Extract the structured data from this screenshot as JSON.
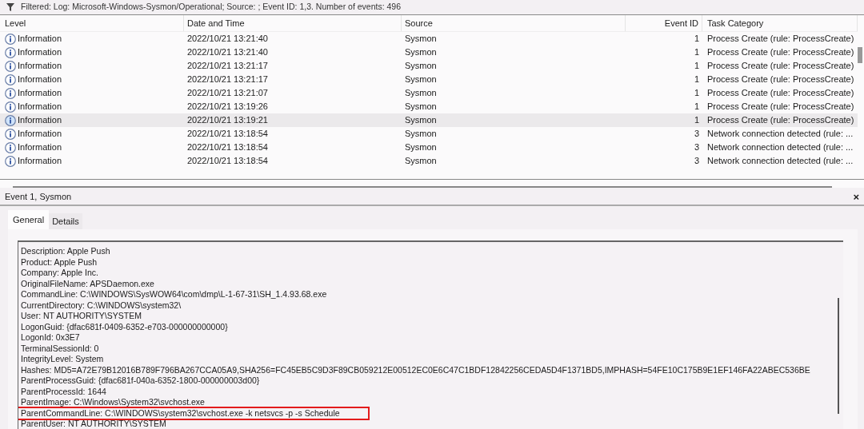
{
  "filter_bar": {
    "text": "Filtered: Log: Microsoft-Windows-Sysmon/Operational; Source: ; Event ID: 1,3. Number of events: 496"
  },
  "table": {
    "columns": [
      "Level",
      "Date and Time",
      "Source",
      "Event ID",
      "Task Category"
    ],
    "rows": [
      {
        "level": "Information",
        "date": "2022/10/21 13:21:40",
        "source": "Sysmon",
        "event_id": "1",
        "category": "Process Create (rule: ProcessCreate)",
        "selected": false
      },
      {
        "level": "Information",
        "date": "2022/10/21 13:21:40",
        "source": "Sysmon",
        "event_id": "1",
        "category": "Process Create (rule: ProcessCreate)",
        "selected": false
      },
      {
        "level": "Information",
        "date": "2022/10/21 13:21:17",
        "source": "Sysmon",
        "event_id": "1",
        "category": "Process Create (rule: ProcessCreate)",
        "selected": false
      },
      {
        "level": "Information",
        "date": "2022/10/21 13:21:17",
        "source": "Sysmon",
        "event_id": "1",
        "category": "Process Create (rule: ProcessCreate)",
        "selected": false
      },
      {
        "level": "Information",
        "date": "2022/10/21 13:21:07",
        "source": "Sysmon",
        "event_id": "1",
        "category": "Process Create (rule: ProcessCreate)",
        "selected": false
      },
      {
        "level": "Information",
        "date": "2022/10/21 13:19:26",
        "source": "Sysmon",
        "event_id": "1",
        "category": "Process Create (rule: ProcessCreate)",
        "selected": false
      },
      {
        "level": "Information",
        "date": "2022/10/21 13:19:21",
        "source": "Sysmon",
        "event_id": "1",
        "category": "Process Create (rule: ProcessCreate)",
        "selected": true
      },
      {
        "level": "Information",
        "date": "2022/10/21 13:18:54",
        "source": "Sysmon",
        "event_id": "3",
        "category": "Network connection detected (rule: ...",
        "selected": false
      },
      {
        "level": "Information",
        "date": "2022/10/21 13:18:54",
        "source": "Sysmon",
        "event_id": "3",
        "category": "Network connection detected (rule: ...",
        "selected": false
      },
      {
        "level": "Information",
        "date": "2022/10/21 13:18:54",
        "source": "Sysmon",
        "event_id": "3",
        "category": "Network connection detected (rule: ...",
        "selected": false
      }
    ]
  },
  "detail_panel": {
    "title": "Event 1, Sysmon",
    "close": "×",
    "tabs": [
      {
        "label": "General",
        "selected": true
      },
      {
        "label": "Details",
        "selected": false
      }
    ],
    "lines": [
      {
        "text": "Description: Apple Push",
        "boxed": false
      },
      {
        "text": "Product: Apple Push",
        "boxed": false
      },
      {
        "text": "Company: Apple Inc.",
        "boxed": false
      },
      {
        "text": "OriginalFileName: APSDaemon.exe",
        "boxed": false
      },
      {
        "text": "CommandLine: C:\\WINDOWS\\SysWOW64\\com\\dmp\\L-1-67-31\\SH_1.4.93.68.exe",
        "boxed": false
      },
      {
        "text": "CurrentDirectory: C:\\WINDOWS\\system32\\",
        "boxed": false
      },
      {
        "text": "User: NT AUTHORITY\\SYSTEM",
        "boxed": false
      },
      {
        "text": "LogonGuid: {dfac681f-0409-6352-e703-000000000000}",
        "boxed": false
      },
      {
        "text": "LogonId: 0x3E7",
        "boxed": false
      },
      {
        "text": "TerminalSessionId: 0",
        "boxed": false
      },
      {
        "text": "IntegrityLevel: System",
        "boxed": false
      },
      {
        "text": "Hashes: MD5=A72E79B12016B789F796BA267CCA05A9,SHA256=FC45EB5C9D3F89CB059212E00512EC0E6C47C1BDF12842256CEDA5D4F1371BD5,IMPHASH=54FE10C175B9E1EF146FA22ABEC536BE",
        "boxed": false
      },
      {
        "text": "ParentProcessGuid: {dfac681f-040a-6352-1800-000000003d00}",
        "boxed": false
      },
      {
        "text": "ParentProcessId: 1644",
        "boxed": false
      },
      {
        "text": "ParentImage: C:\\Windows\\System32\\svchost.exe",
        "boxed": false
      },
      {
        "text": "ParentCommandLine: C:\\WINDOWS\\system32\\svchost.exe -k netsvcs -p -s Schedule",
        "boxed": true
      },
      {
        "text": "ParentUser: NT AUTHORITY\\SYSTEM",
        "boxed": false
      }
    ]
  }
}
